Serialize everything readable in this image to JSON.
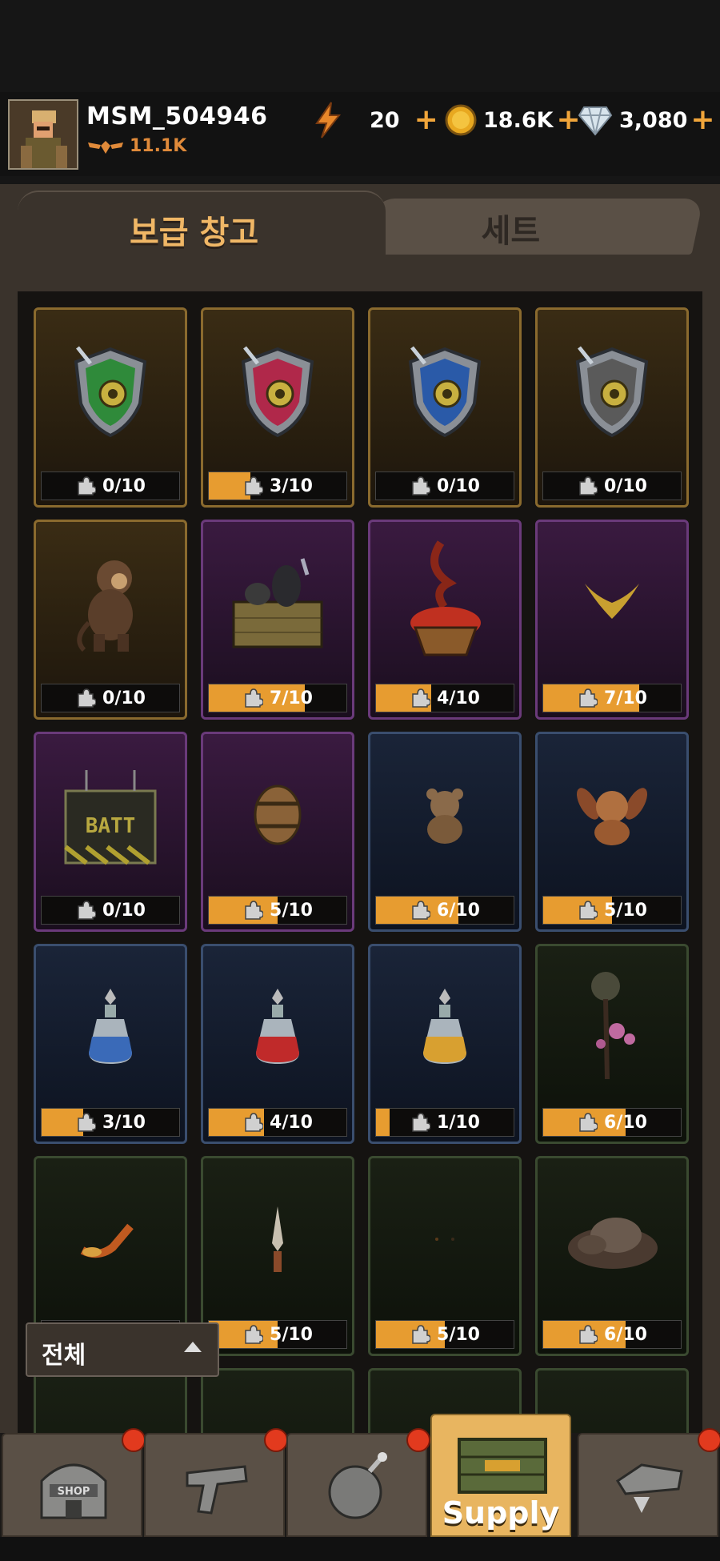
{
  "player": {
    "name": "MSM_504946",
    "rank": "11.1K"
  },
  "resources": {
    "energy": "20",
    "gold": "18.6K",
    "gems": "3,080"
  },
  "tabs": {
    "active": "보급 창고",
    "inactive": "세트"
  },
  "filter": {
    "label": "전체"
  },
  "items": [
    {
      "name": "green-shield",
      "rarity": "gold",
      "progress": "0/10",
      "fill": 0
    },
    {
      "name": "red-shield",
      "rarity": "gold",
      "progress": "3/10",
      "fill": 0.3
    },
    {
      "name": "blue-shield",
      "rarity": "gold",
      "progress": "0/10",
      "fill": 0
    },
    {
      "name": "gray-shield",
      "rarity": "gold",
      "progress": "0/10",
      "fill": 0
    },
    {
      "name": "monkey",
      "rarity": "gold",
      "progress": "0/10",
      "fill": 0
    },
    {
      "name": "weapon-crate",
      "rarity": "purple",
      "progress": "7/10",
      "fill": 0.7
    },
    {
      "name": "fire-basket",
      "rarity": "purple",
      "progress": "4/10",
      "fill": 0.4
    },
    {
      "name": "gold-horns",
      "rarity": "purple",
      "progress": "7/10",
      "fill": 0.7
    },
    {
      "name": "batt-box",
      "rarity": "purple",
      "progress": "0/10",
      "fill": 0
    },
    {
      "name": "barrel",
      "rarity": "purple",
      "progress": "5/10",
      "fill": 0.5
    },
    {
      "name": "teddy-bear",
      "rarity": "blue",
      "progress": "6/10",
      "fill": 0.6
    },
    {
      "name": "bunny-doll",
      "rarity": "blue",
      "progress": "5/10",
      "fill": 0.5
    },
    {
      "name": "blue-potion",
      "rarity": "blue",
      "progress": "3/10",
      "fill": 0.3
    },
    {
      "name": "red-potion",
      "rarity": "blue",
      "progress": "4/10",
      "fill": 0.4
    },
    {
      "name": "yellow-potion",
      "rarity": "blue",
      "progress": "1/10",
      "fill": 0.1
    },
    {
      "name": "flower-plant",
      "rarity": "green",
      "progress": "6/10",
      "fill": 0.6
    },
    {
      "name": "pipe",
      "rarity": "green",
      "progress": "",
      "fill": 0
    },
    {
      "name": "knife",
      "rarity": "green",
      "progress": "5/10",
      "fill": 0.5
    },
    {
      "name": "dark-item",
      "rarity": "green",
      "progress": "5/10",
      "fill": 0.5
    },
    {
      "name": "rock-pile",
      "rarity": "green",
      "progress": "6/10",
      "fill": 0.6
    }
  ],
  "nav": [
    {
      "id": "shop",
      "label": "",
      "icon": "shop-icon",
      "badge": true
    },
    {
      "id": "gun",
      "label": "",
      "icon": "gun-icon",
      "badge": true
    },
    {
      "id": "bomb",
      "label": "",
      "icon": "bomb-icon",
      "badge": true
    },
    {
      "id": "supply",
      "label": "Supply",
      "icon": "supply-crate-icon",
      "badge": false,
      "active": true
    },
    {
      "id": "vehicle",
      "label": "",
      "icon": "vehicle-icon",
      "badge": true
    }
  ]
}
